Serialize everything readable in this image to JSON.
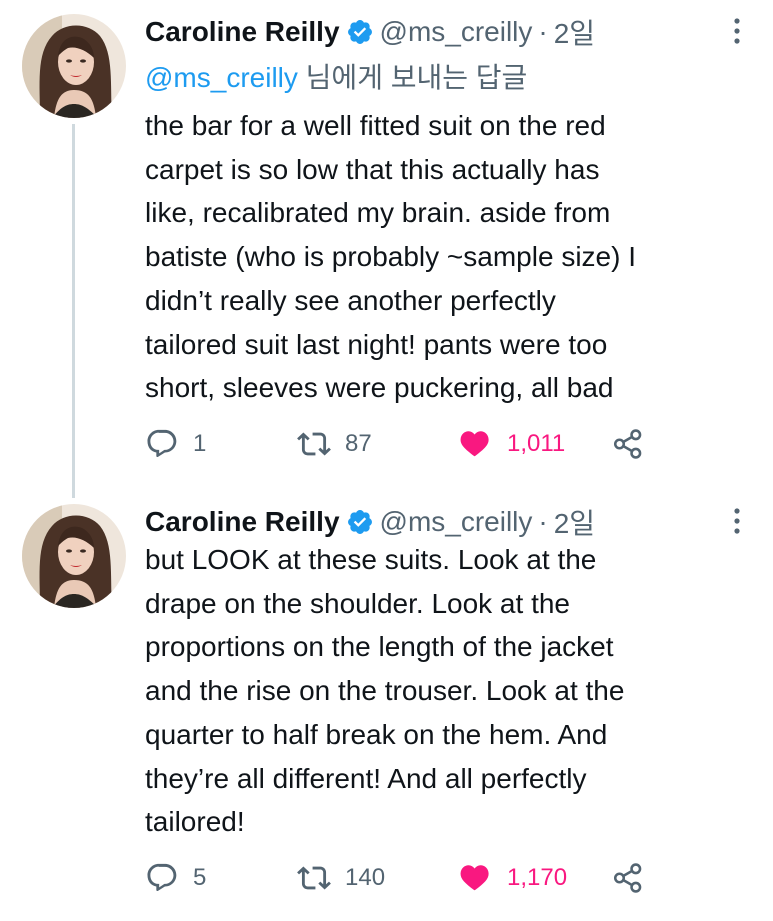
{
  "tweets": [
    {
      "author": {
        "name": "Caroline Reilly",
        "handle": "@ms_creilly",
        "verified": true
      },
      "time": "2일",
      "reply_to": {
        "mention": "@ms_creilly",
        "suffix": " 님에게 보내는 답글"
      },
      "text": "the bar for a well fitted suit on the red\ncarpet is so low that this actually has\nlike, recalibrated my brain. aside from\nbatiste (who is probably ~sample size) I\ndidn’t really see another perfectly\ntailored suit last night! pants were too\nshort, sleeves were puckering, all bad",
      "stats": {
        "replies": "1",
        "retweets": "87",
        "likes": "1,011"
      },
      "liked": true
    },
    {
      "author": {
        "name": "Caroline Reilly",
        "handle": "@ms_creilly",
        "verified": true
      },
      "time": "2일",
      "text": "but LOOK at these suits. Look at the\ndrape on the shoulder. Look at the\nproportions on the length of the jacket\nand the rise on the trouser. Look at the\nquarter to half break on the hem. And\nthey’re all different! And all perfectly\ntailored!",
      "stats": {
        "replies": "5",
        "retweets": "140",
        "likes": "1,170"
      },
      "liked": true
    }
  ],
  "colors": {
    "accent": "#1d9bf0",
    "like": "#f91880",
    "secondary_text": "#536471",
    "text": "#0f1419"
  },
  "icons": [
    "verified-badge-icon",
    "more-options-icon",
    "reply-icon",
    "retweet-icon",
    "like-heart-icon",
    "share-icon"
  ]
}
